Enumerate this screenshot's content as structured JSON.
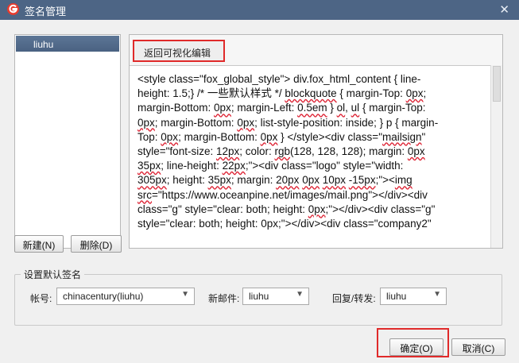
{
  "window": {
    "title": "签名管理",
    "close_glyph": "✕"
  },
  "accounts": [
    {
      "label": "liuhu",
      "selected": true
    }
  ],
  "editor": {
    "tab_label": "返回可视化编辑",
    "lines": [
      [
        {
          "t": "<style class=\"fox_global_style\"> div.fox_html_content { line-"
        }
      ],
      [
        {
          "t": "height: 1.5;} /* 一些默认样式 */ "
        },
        {
          "t": "blockquote",
          "u": true
        },
        {
          "t": " { margin-Top: "
        },
        {
          "t": "0px",
          "u": true
        },
        {
          "t": ";"
        }
      ],
      [
        {
          "t": "margin-Bottom: "
        },
        {
          "t": "0px",
          "u": true
        },
        {
          "t": "; margin-Left: "
        },
        {
          "t": "0.5em",
          "u": true
        },
        {
          "t": " } "
        },
        {
          "t": "ol",
          "u": true
        },
        {
          "t": ", "
        },
        {
          "t": "ul",
          "u": true
        },
        {
          "t": " { margin-Top:"
        }
      ],
      [
        {
          "t": "0px",
          "u": true
        },
        {
          "t": "; margin-Bottom: "
        },
        {
          "t": "0px",
          "u": true
        },
        {
          "t": "; list-style-position: inside; } p { margin-"
        }
      ],
      [
        {
          "t": "Top: "
        },
        {
          "t": "0px",
          "u": true
        },
        {
          "t": "; margin-Bottom: "
        },
        {
          "t": "0px",
          "u": true
        },
        {
          "t": " } </style><div class=\""
        },
        {
          "t": "mailsign",
          "u": true
        },
        {
          "t": "\""
        }
      ],
      [
        {
          "t": "style=\"font-size: "
        },
        {
          "t": "12px",
          "u": true
        },
        {
          "t": "; color: "
        },
        {
          "t": "rgb",
          "u": true
        },
        {
          "t": "(128, 128, 128); margin: "
        },
        {
          "t": "0px",
          "u": true
        }
      ],
      [
        {
          "t": "35px",
          "u": true
        },
        {
          "t": "; line-height: "
        },
        {
          "t": "22px",
          "u": true
        },
        {
          "t": ";\"><div class=\"logo\" style=\"width:"
        }
      ],
      [
        {
          "t": "305px",
          "u": true
        },
        {
          "t": "; height: "
        },
        {
          "t": "35px",
          "u": true
        },
        {
          "t": "; margin: "
        },
        {
          "t": "20px",
          "u": true
        },
        {
          "t": " "
        },
        {
          "t": "0px",
          "u": true
        },
        {
          "t": " "
        },
        {
          "t": "10px",
          "u": true
        },
        {
          "t": " "
        },
        {
          "t": "-15px",
          "u": true
        },
        {
          "t": ";\"><"
        },
        {
          "t": "img",
          "u": true
        }
      ],
      [
        {
          "t": "src",
          "u": true
        },
        {
          "t": "=\"https://www.oceanpine.net/images/mail.png\"></div><div"
        }
      ],
      [
        {
          "t": "class=\"g\" style=\"clear: both; height: "
        },
        {
          "t": "0px",
          "u": true
        },
        {
          "t": ";\"></div><div class=\"g\""
        }
      ],
      [
        {
          "t": "style=\"clear: both; height: 0px;\"></div><div class=\"company2\""
        }
      ]
    ]
  },
  "buttons": {
    "new": "新建(N)",
    "delete": "删除(D)",
    "ok": "确定(O)",
    "cancel": "取消(C)"
  },
  "default_sig": {
    "group_label": "设置默认签名",
    "account_label": "帐号:",
    "account_value": "chinacentury(liuhu)",
    "new_mail_label": "新邮件:",
    "new_mail_value": "liuhu",
    "reply_label": "回复/转发:",
    "reply_value": "liuhu"
  },
  "colors": {
    "titlebar": "#4d6585",
    "highlight": "#e02a2a",
    "selected_item": "#4a6282"
  }
}
